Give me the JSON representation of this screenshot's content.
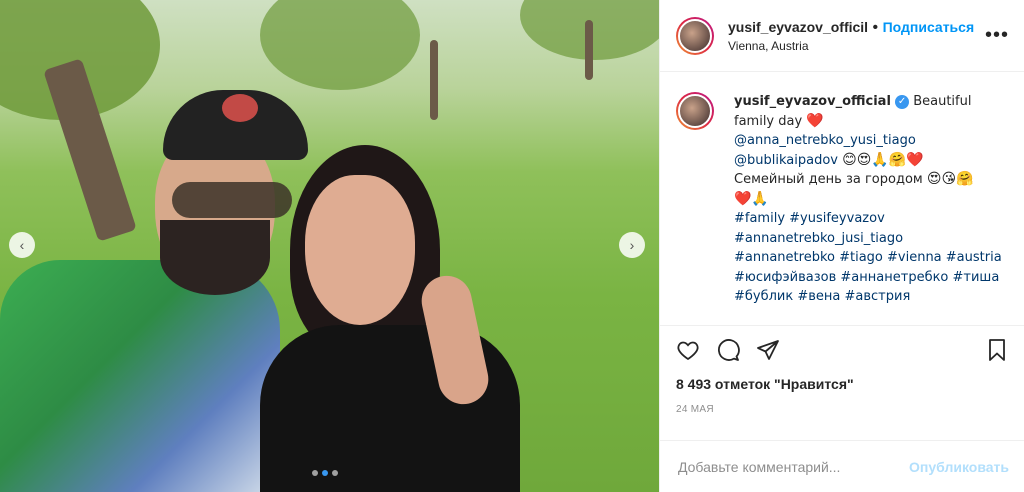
{
  "header": {
    "username": "yusif_eyvazov_officil",
    "separator": "•",
    "follow_label": "Подписаться",
    "location": "Vienna, Austria",
    "more_label": "•••"
  },
  "caption": {
    "username": "yusif_eyvazov_official",
    "verified_glyph": "✓",
    "line1": "Beautiful",
    "line2": "family day",
    "emoji_heart": "❤️",
    "mention1": "@anna_netrebko_yusi_tiago",
    "mention2": "@bublikaipadov",
    "emojis1": "😊😍🙏🤗❤️",
    "line3": "Семейный день за городом",
    "emojis2": "😍😘🤗",
    "emojis3": "❤️🙏",
    "hashtags": [
      "#family #yusifeyvazov",
      "#annanetrebko_jusi_tiago",
      "#annanetrebko #tiago #vienna #austria",
      "#юсифэйвазов #аннанетребко #тиша",
      "#бублик #вена #австрия"
    ]
  },
  "likes": "8 493 отметок \"Нравится\"",
  "date": "24 мая",
  "comment": {
    "placeholder": "Добавьте комментарий...",
    "publish_label": "Опубликовать"
  },
  "carousel": {
    "prev_glyph": "‹",
    "next_glyph": "›",
    "active_index": 1,
    "count": 3
  },
  "colors": {
    "accent": "#0095f6",
    "link": "#00376b",
    "muted": "#8e8e8e"
  }
}
